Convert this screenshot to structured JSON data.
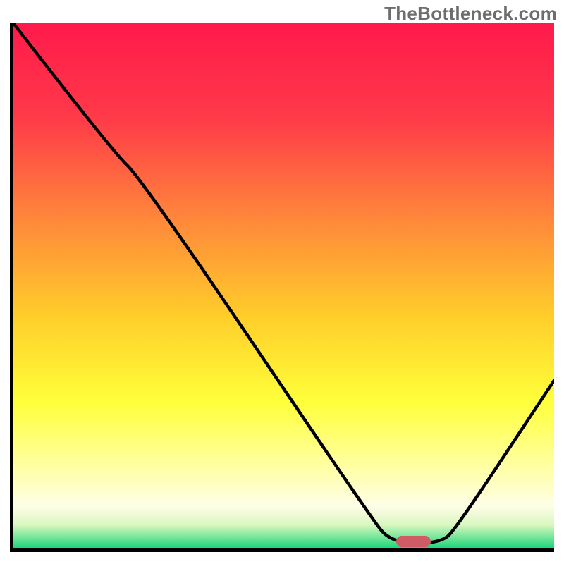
{
  "watermark": "TheBottleneck.com",
  "chart_data": {
    "type": "line",
    "title": "",
    "xlabel": "",
    "ylabel": "",
    "xlim": [
      0,
      100
    ],
    "ylim": [
      0,
      100
    ],
    "gradient_stops": [
      {
        "offset": 0.0,
        "color": "#ff1a4b"
      },
      {
        "offset": 0.18,
        "color": "#ff3a49"
      },
      {
        "offset": 0.38,
        "color": "#ff8a3a"
      },
      {
        "offset": 0.56,
        "color": "#ffce2a"
      },
      {
        "offset": 0.72,
        "color": "#ffff3a"
      },
      {
        "offset": 0.84,
        "color": "#ffffa0"
      },
      {
        "offset": 0.92,
        "color": "#fefee7"
      },
      {
        "offset": 0.955,
        "color": "#d9f7c0"
      },
      {
        "offset": 0.975,
        "color": "#84e89e"
      },
      {
        "offset": 1.0,
        "color": "#17d67d"
      }
    ],
    "series": [
      {
        "name": "bottleneck-curve",
        "points": [
          {
            "x": 0,
            "y": 100
          },
          {
            "x": 18,
            "y": 76
          },
          {
            "x": 24,
            "y": 70
          },
          {
            "x": 66,
            "y": 6
          },
          {
            "x": 70,
            "y": 1
          },
          {
            "x": 79,
            "y": 1
          },
          {
            "x": 82,
            "y": 4
          },
          {
            "x": 100,
            "y": 32
          }
        ]
      }
    ],
    "marker": {
      "x_center_pct": 74,
      "y_pct": 1.3,
      "width_pct": 6.5
    }
  }
}
